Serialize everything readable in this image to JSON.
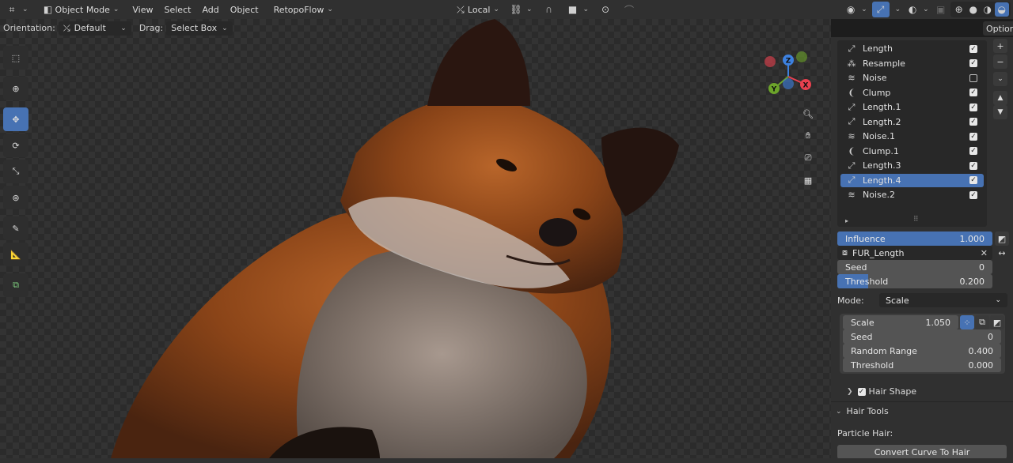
{
  "header": {
    "mode": "Object Mode",
    "menu": [
      "View",
      "Select",
      "Add",
      "Object",
      "RetopoFlow"
    ],
    "transform_orientation": "Local",
    "options_label": "Option"
  },
  "tool_settings": {
    "orientation_label": "Orientation:",
    "orientation_value": "Default",
    "drag_label": "Drag:",
    "drag_value": "Select Box"
  },
  "gizmo": {
    "z": "Z",
    "y": "Y",
    "x": "X"
  },
  "modifier_list": [
    {
      "label": "Length",
      "icon": "length-icon",
      "checked": true
    },
    {
      "label": "Resample",
      "icon": "resample-icon",
      "checked": true
    },
    {
      "label": "Noise",
      "icon": "noise-icon",
      "checked": false
    },
    {
      "label": "Clump",
      "icon": "clump-icon",
      "checked": true
    },
    {
      "label": "Length.1",
      "icon": "length-icon",
      "checked": true
    },
    {
      "label": "Length.2",
      "icon": "length-icon",
      "checked": true
    },
    {
      "label": "Noise.1",
      "icon": "noise-icon",
      "checked": true
    },
    {
      "label": "Clump.1",
      "icon": "clump-icon",
      "checked": true
    },
    {
      "label": "Length.3",
      "icon": "length-icon",
      "checked": true
    },
    {
      "label": "Length.4",
      "icon": "length-icon",
      "checked": true,
      "selected": true
    },
    {
      "label": "Noise.2",
      "icon": "noise-icon",
      "checked": true
    }
  ],
  "properties": {
    "influence_label": "Influence",
    "influence_value": "1.000",
    "influence_fraction": 1.0,
    "node_group": "FUR_Length",
    "seed_label": "Seed",
    "seed_value": "0",
    "threshold_label": "Threshold",
    "threshold_value": "0.200",
    "threshold_fraction": 0.2,
    "mode_label": "Mode:",
    "mode_value": "Scale",
    "scale_label": "Scale",
    "scale_value": "1.050",
    "seed2_label": "Seed",
    "seed2_value": "0",
    "random_range_label": "Random Range",
    "random_range_value": "0.400",
    "threshold2_label": "Threshold",
    "threshold2_value": "0.000",
    "hair_shape_label": "Hair Shape",
    "hair_tools_label": "Hair Tools",
    "particle_hair_label": "Particle Hair:",
    "convert_button": "Convert Curve To Hair"
  },
  "colors": {
    "accent": "#4772b3",
    "gizmo_x": "#e8414f",
    "gizmo_y": "#6ca42a",
    "gizmo_z": "#3d81e0"
  }
}
